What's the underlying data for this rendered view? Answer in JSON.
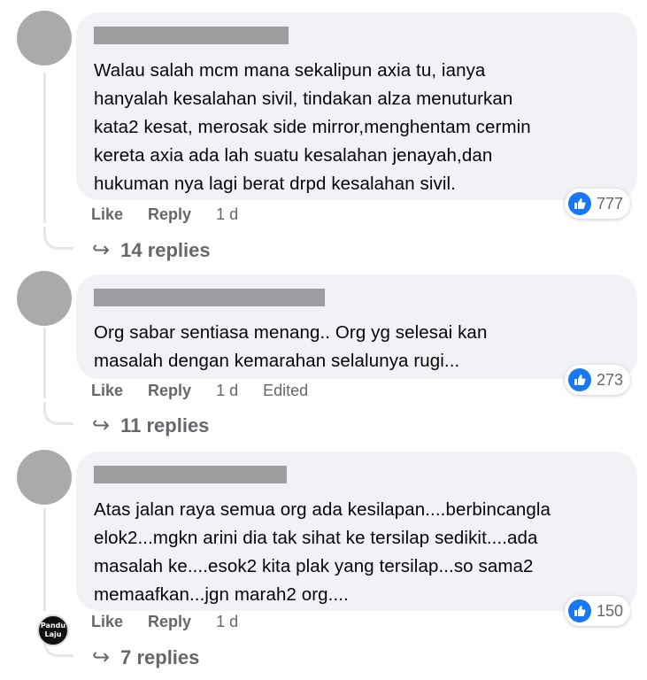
{
  "comments": [
    {
      "text": "Walau salah mcm mana sekalipun axia tu, ianya\nhanyalah kesalahan sivil, tindakan alza menuturkan\nkata2 kesat, merosak side mirror,menghentam cermin\nkereta axia ada lah suatu kesalahan jenayah,dan\nhukuman nya lagi berat drpd kesalahan sivil.",
      "like_label": "Like",
      "reply_label": "Reply",
      "time": "1 d",
      "edited": "",
      "reaction_count": "777",
      "replies_label": "14 replies"
    },
    {
      "text": "Org sabar sentiasa menang.. Org yg selesai kan\nmasalah dengan kemarahan selalunya rugi...",
      "like_label": "Like",
      "reply_label": "Reply",
      "time": "1 d",
      "edited": "Edited",
      "reaction_count": "273",
      "replies_label": "11 replies"
    },
    {
      "text": "Atas jalan raya semua org ada kesilapan....berbincangla\nelok2...mgkn arini dia tak sihat ke tersilap sedikit....ada\nmasalah ke....esok2 kita plak yang tersilap...so sama2\nmemaafkan...jgn marah2 org....",
      "like_label": "Like",
      "reply_label": "Reply",
      "time": "1 d",
      "edited": "",
      "reaction_count": "150",
      "replies_label": "7 replies"
    }
  ],
  "watermark": {
    "line1": "Pandu",
    "line2": "Laju"
  },
  "colors": {
    "bubble": "#f0f2f5",
    "like_blue": "#1877f2",
    "meta_grey": "#65676b",
    "redacted_name": "#9d9ea0"
  }
}
